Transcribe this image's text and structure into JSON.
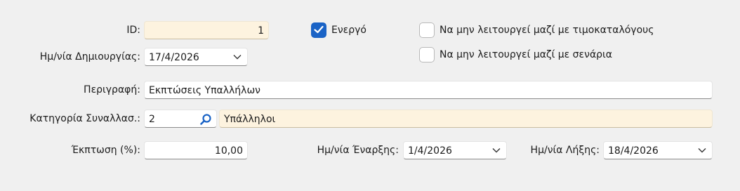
{
  "form": {
    "id_label": "ID:",
    "id_value": "1",
    "created_label": "Ημ/νία Δημιουργίας:",
    "created_value": "17/4/2026",
    "description_label": "Περιγραφή:",
    "description_value": "Εκπτώσεις Υπαλλήλων",
    "category_label": "Κατηγορία Συναλλασ.:",
    "category_code": "2",
    "category_name": "Υπάλληλοι",
    "discount_label": "Έκπτωση (%):",
    "discount_value": "10,00",
    "start_label": "Ημ/νία Έναρξης:",
    "start_value": "1/4/2026",
    "end_label": "Ημ/νία Λήξης:",
    "end_value": "18/4/2026"
  },
  "checkboxes": {
    "active_label": "Ενεργό",
    "active_checked": true,
    "no_pricelists_label": "Να μην λειτουργεί μαζί με τιμοκαταλόγους",
    "no_pricelists_checked": false,
    "no_scenarios_label": "Να μην λειτουργεί μαζί με σενάρια",
    "no_scenarios_checked": false
  },
  "colors": {
    "accent": "#1a63c6",
    "readonly_bg": "#fdf3df",
    "window_bg": "#f0f0f0"
  },
  "icons": {
    "lookup": "search-icon",
    "dropdown": "chevron-down-icon",
    "check": "checkmark-icon"
  }
}
